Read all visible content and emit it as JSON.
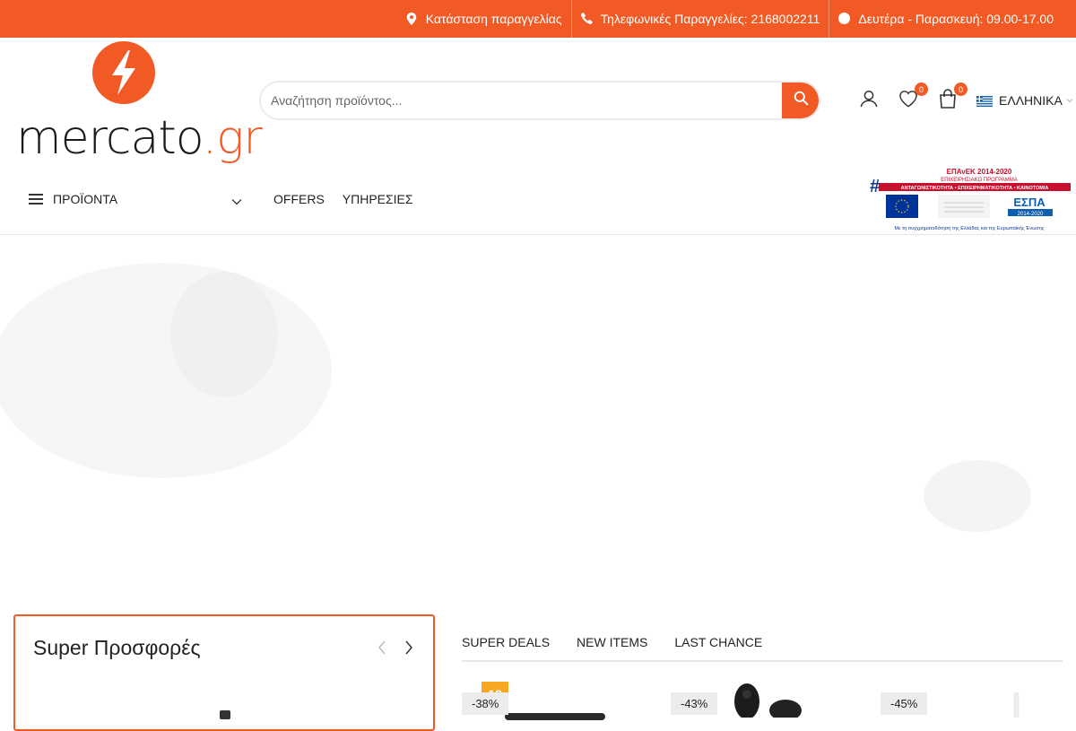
{
  "topbar": {
    "order_status": "Κατάσταση παραγγελίας",
    "phone_orders": "Τηλεφωνικές Παραγγελίες: 2168002211",
    "hours": "Δευτέρα - Παρασκευή: 09.00-17.00"
  },
  "brand": {
    "name": "mercato",
    "tld": ".gr",
    "accent_color": "#f15a24"
  },
  "search": {
    "placeholder": "Αναζήτηση προϊόντος..."
  },
  "header_icons": {
    "wishlist_count": "0",
    "cart_count": "0",
    "language": "ΕΛΛΗΝΙΚΑ"
  },
  "nav": {
    "categories_label": "ΠΡΟΪΟΝΤΑ",
    "links": [
      "OFFERS",
      "ΥΠΗΡΕΣΙΕΣ"
    ]
  },
  "espa_banner": {
    "title": "ΕΠΑνΕΚ 2014-2020",
    "line1": "ΕΠΙΧΕΙΡΗΣΙΑΚΟ ΠΡΟΓΡΑΜΜΑ",
    "line2": "ΑΝΤΑΓΩΝΙΣΤΙΚΟΤΗΤΑ • ΕΠΙΧΕΙΡΗΜΑΤΙΚΟΤΗΤΑ • ΚΑΙΝΟΤΟΜΙΑ",
    "espa": "ΕΣΠΑ",
    "espa_years": "2014-2020",
    "footer": "Με τη συγχρηματοδότηση της Ελλάδας και της Ευρωπαϊκής Ένωσης"
  },
  "deals": {
    "title": "Super Προσφορές"
  },
  "tabs": [
    "SUPER DEALS",
    "NEW ITEMS",
    "LAST CHANCE"
  ],
  "products": [
    {
      "discount": "-38%",
      "badge": "18"
    },
    {
      "discount": "-43%"
    },
    {
      "discount": "-45%"
    }
  ]
}
